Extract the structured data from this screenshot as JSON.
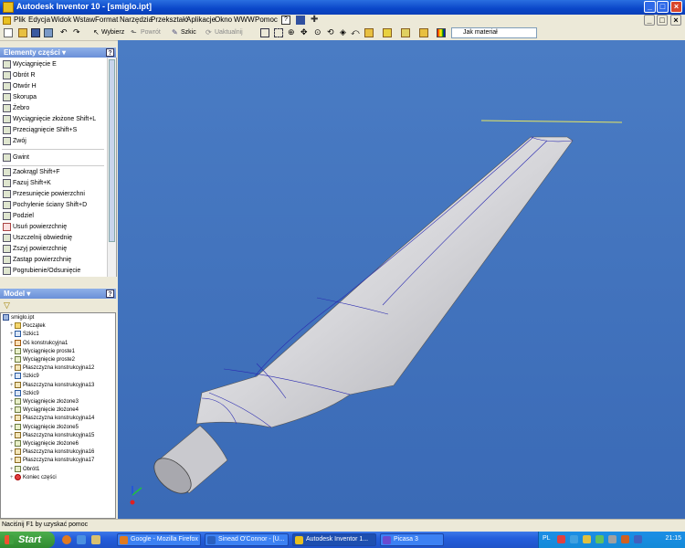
{
  "window": {
    "title": "Autodesk Inventor 10 - [smiglo.ipt]",
    "controls": {
      "min": "_",
      "max": "□",
      "close": "×"
    },
    "inner_controls": {
      "min": "_",
      "max": "□",
      "close": "×"
    }
  },
  "menu": {
    "items": [
      "Plik",
      "Edycja",
      "Widok",
      "Wstaw",
      "Format",
      "Narzędzia",
      "Przekształć",
      "Aplikacje",
      "Okno",
      "WWW",
      "Pomoc"
    ]
  },
  "toolbar": {
    "select_label": "Wybierz",
    "return_label": "Powrót",
    "sketch_label": "Szkic",
    "update_label": "Uaktualnij",
    "material_dropdown": "Jak materiał"
  },
  "features_panel": {
    "title": "Elementy części",
    "items": [
      {
        "label": "Wyciągnięcie    E"
      },
      {
        "label": "Obrót    R"
      },
      {
        "label": "Otwór    H"
      },
      {
        "label": "Skorupa"
      },
      {
        "label": "Żebro"
      },
      {
        "label": "Wyciągnięcie złożone    Shift+L"
      },
      {
        "label": "Przeciągnięcie    Shift+S"
      },
      {
        "label": "Zwój"
      },
      {
        "label": "Gwint"
      },
      {
        "label": "Zaokrągl    Shift+F"
      },
      {
        "label": "Fazuj    Shift+K"
      },
      {
        "label": "Przesunięcie powierzchni"
      },
      {
        "label": "Pochylenie ściany    Shift+D"
      },
      {
        "label": "Podziel"
      },
      {
        "label": "Usuń powierzchnię"
      },
      {
        "label": "Uszczelnij obwiednię"
      },
      {
        "label": "Zszyj powierzchnię"
      },
      {
        "label": "Zastąp powierzchnię"
      },
      {
        "label": "Pogrubienie/Odsunięcie"
      }
    ]
  },
  "model_panel": {
    "title": "Model",
    "tree": [
      {
        "label": "smiglo.ipt",
        "kind": "root",
        "depth": 0
      },
      {
        "label": "Początek",
        "kind": "fo",
        "depth": 1
      },
      {
        "label": "Szkic1",
        "kind": "sk",
        "depth": 1
      },
      {
        "label": "Oś konstrukcyjna1",
        "kind": "ax",
        "depth": 1
      },
      {
        "label": "Wyciągnięcie proste1",
        "kind": "ft",
        "depth": 1
      },
      {
        "label": "Wyciągnięcie proste2",
        "kind": "ft",
        "depth": 1
      },
      {
        "label": "Płaszczyzna konstrukcyjna12",
        "kind": "pl",
        "depth": 1
      },
      {
        "label": "Szkic9",
        "kind": "sk",
        "depth": 1
      },
      {
        "label": "Płaszczyzna konstrukcyjna13",
        "kind": "pl",
        "depth": 1
      },
      {
        "label": "Szkic9",
        "kind": "sk",
        "depth": 1
      },
      {
        "label": "Wyciągnięcie złożone3",
        "kind": "ft",
        "depth": 1
      },
      {
        "label": "Wyciągnięcie złożone4",
        "kind": "ft",
        "depth": 1
      },
      {
        "label": "Płaszczyzna konstrukcyjna14",
        "kind": "pl",
        "depth": 1
      },
      {
        "label": "Wyciągnięcie złożone5",
        "kind": "ft",
        "depth": 1
      },
      {
        "label": "Płaszczyzna konstrukcyjna15",
        "kind": "pl",
        "depth": 1
      },
      {
        "label": "Wyciągnięcie złożone6",
        "kind": "ft",
        "depth": 1
      },
      {
        "label": "Płaszczyzna konstrukcyjna16",
        "kind": "pl",
        "depth": 1
      },
      {
        "label": "Płaszczyzna konstrukcyjna17",
        "kind": "pl",
        "depth": 1
      },
      {
        "label": "Obrót1",
        "kind": "ft",
        "depth": 1
      },
      {
        "label": "Koniec części",
        "kind": "end",
        "depth": 1
      }
    ]
  },
  "status": {
    "text": "Naciśnij F1 by uzyskać pomoc"
  },
  "taskbar": {
    "start_label": "Start",
    "tasks": [
      {
        "label": "Google - Mozilla Firefox",
        "color": "#e07a20"
      },
      {
        "label": "Sinead O'Connor - [U...",
        "color": "#2a60c0"
      },
      {
        "label": "Autodesk Inventor 1...",
        "color": "#e8c020"
      },
      {
        "label": "Picasa 3",
        "color": "#6a4ad0"
      }
    ],
    "lang": "PL",
    "clock": "21:15"
  },
  "colors": {
    "viewport_bg": "#3f71bd",
    "part_body": "#d8d8dc",
    "edges": "#2a2ab0"
  }
}
